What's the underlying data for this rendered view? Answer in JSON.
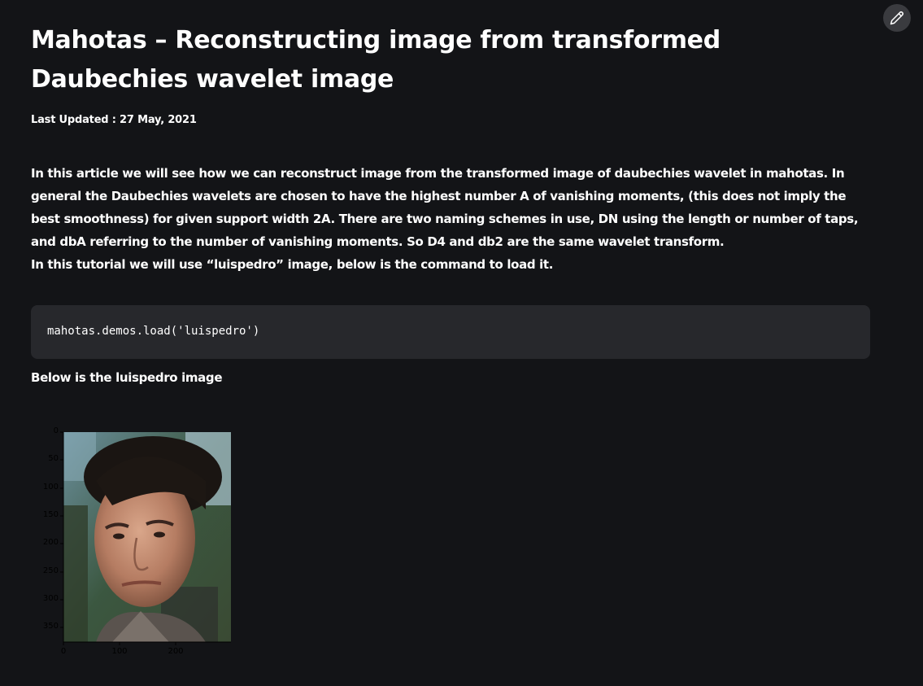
{
  "article": {
    "title": "Mahotas – Reconstructing image from transformed Daubechies wavelet image",
    "last_updated": "Last Updated : 27 May, 2021",
    "intro_lines": [
      "In this article we will see how we can reconstruct image from the transformed image of daubechies wavelet in mahotas. In general the Daubechies wavelets are chosen to have the highest number A of vanishing moments, (this does not imply the best smoothness) for given support width 2A. There are two naming schemes in use, DN using the length or number of taps, and dbA referring to the number of vanishing moments. So D4 and db2 are the same wavelet transform.",
      "In this tutorial we will use “luispedro” image, below is the command to load it."
    ],
    "code": "mahotas.demos.load('luispedro')",
    "below_text": "Below is the luispedro image"
  },
  "figure": {
    "y_ticks": [
      "0",
      "50",
      "100",
      "150",
      "200",
      "250",
      "300",
      "350"
    ],
    "x_ticks": [
      "0",
      "100",
      "200"
    ]
  },
  "toolbar": {
    "edit_icon": "pencil-icon"
  },
  "colors": {
    "background": "#131417",
    "code_background": "#27282c",
    "text": "#ffffff",
    "edit_button": "#3a3b3f"
  }
}
